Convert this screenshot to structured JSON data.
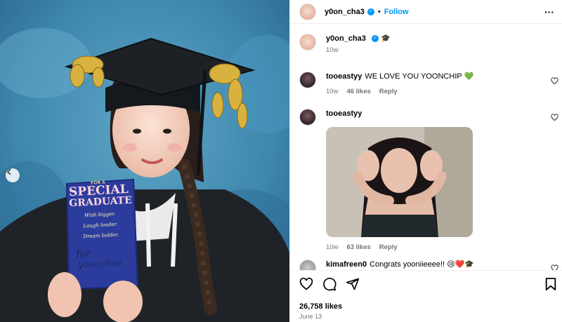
{
  "post": {
    "username": "y0on_cha3",
    "follow_label": "Follow",
    "separator": "•",
    "caption_emoji": "🎓",
    "caption_age": "10w",
    "likes_count": "26,758 likes",
    "date": "June 13"
  },
  "card": {
    "for_a": "FOR A",
    "special": "SPECIAL",
    "graduate": "GRADUATE",
    "wish_lines": [
      "Wish bigger.",
      "Laugh louder.",
      "Dream bolder."
    ],
    "for_word": "for",
    "recipient": "yoonchae"
  },
  "comments": [
    {
      "username": "tooeastyy",
      "text": "WE LOVE YOU YOONCHIP",
      "emoji": "💚",
      "age": "10w",
      "likes": "46 likes",
      "reply_label": "Reply"
    },
    {
      "username": "tooeastyy",
      "text": "",
      "age": "10w",
      "likes": "63 likes",
      "reply_label": "Reply",
      "has_gif": true
    },
    {
      "username": "kimafreen0",
      "text": "Congrats yooniieeee!!",
      "emoji": "😢❤️🎓"
    }
  ],
  "icons": {
    "more": "more-options-icon",
    "like": "heart-icon",
    "comment": "comment-icon",
    "share": "share-icon",
    "save": "bookmark-icon",
    "verified": "verified-badge-icon",
    "prev": "chevron-left-icon"
  },
  "colors": {
    "accent": "#0095f6",
    "meta_gray": "#737373",
    "backdrop": "#3f8ab0"
  }
}
